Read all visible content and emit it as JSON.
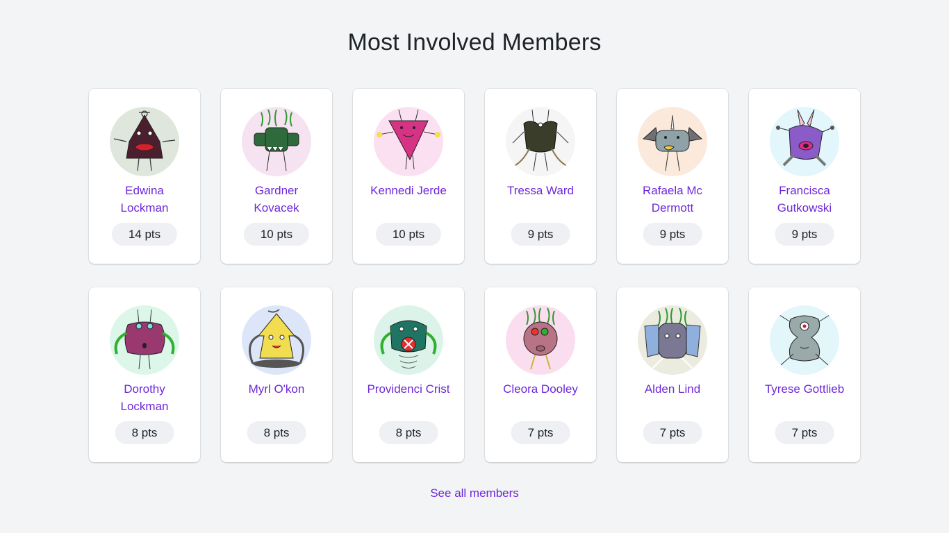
{
  "page": {
    "title": "Most Involved Members",
    "see_all_label": "See all members",
    "accent_color": "#6d28d9"
  },
  "members": [
    {
      "name": "Edwina Lockman",
      "points": "14 pts",
      "avatar_bg": "#dfe7dd",
      "avatar_icon": "monster-avatar-icon"
    },
    {
      "name": "Gardner Kovacek",
      "points": "10 pts",
      "avatar_bg": "#f6e3f2",
      "avatar_icon": "monster-avatar-icon"
    },
    {
      "name": "Kennedi Jerde",
      "points": "10 pts",
      "avatar_bg": "#fbe0f2",
      "avatar_icon": "monster-avatar-icon"
    },
    {
      "name": "Tressa Ward",
      "points": "9 pts",
      "avatar_bg": "#f5f5f5",
      "avatar_icon": "monster-avatar-icon"
    },
    {
      "name": "Rafaela Mc Dermott",
      "points": "9 pts",
      "avatar_bg": "#fbeadb",
      "avatar_icon": "monster-avatar-icon"
    },
    {
      "name": "Francisca Gutkowski",
      "points": "9 pts",
      "avatar_bg": "#e3f6fb",
      "avatar_icon": "monster-avatar-icon"
    },
    {
      "name": "Dorothy Lockman",
      "points": "8 pts",
      "avatar_bg": "#dcf6ea",
      "avatar_icon": "monster-avatar-icon"
    },
    {
      "name": "Myrl O'kon",
      "points": "8 pts",
      "avatar_bg": "#dde6f8",
      "avatar_icon": "monster-avatar-icon"
    },
    {
      "name": "Providenci Crist",
      "points": "8 pts",
      "avatar_bg": "#dcf3ea",
      "avatar_icon": "monster-avatar-icon"
    },
    {
      "name": "Cleora Dooley",
      "points": "7 pts",
      "avatar_bg": "#fbddf0",
      "avatar_icon": "monster-avatar-icon"
    },
    {
      "name": "Alden Lind",
      "points": "7 pts",
      "avatar_bg": "#ecebe0",
      "avatar_icon": "monster-avatar-icon"
    },
    {
      "name": "Tyrese Gottlieb",
      "points": "7 pts",
      "avatar_bg": "#e3f6fa",
      "avatar_icon": "monster-avatar-icon"
    }
  ]
}
